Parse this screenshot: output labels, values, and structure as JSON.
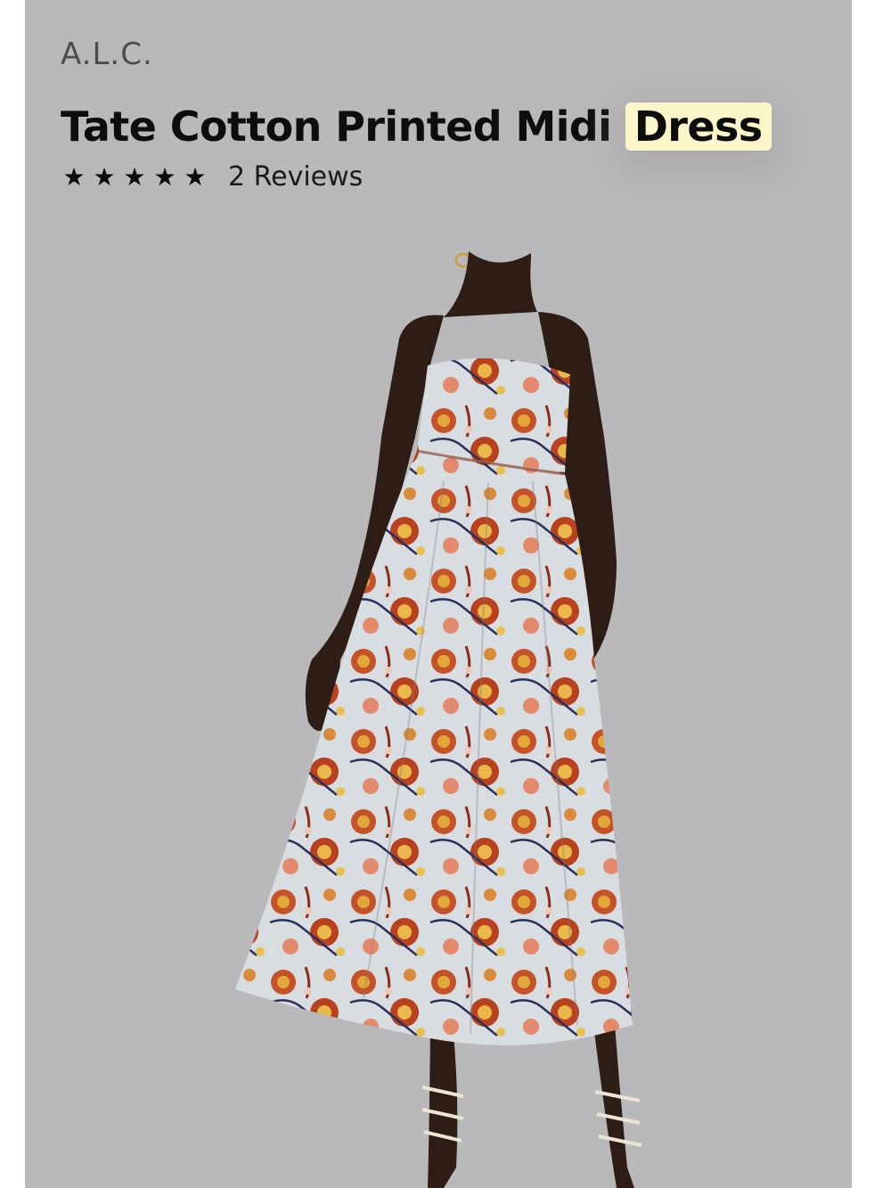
{
  "product": {
    "brand": "A.L.C.",
    "title_main": "Tate Cotton Printed Midi",
    "title_highlight": "Dress",
    "rating": {
      "stars": 5,
      "star_glyph": "★",
      "reviews_label": "2 Reviews"
    }
  },
  "colors": {
    "panel_background": "#b9b9bb",
    "highlight_background": "#fdf6cb",
    "text_primary": "#0d0d0d",
    "brand_text": "#4c4c4e"
  }
}
